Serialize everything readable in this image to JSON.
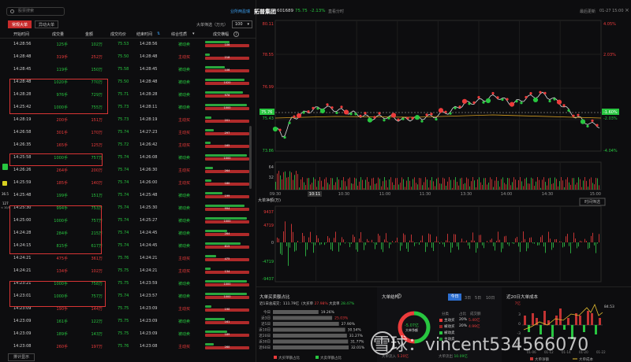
{
  "search": {
    "placeholder": "股票搜索"
  },
  "tabs": [
    {
      "label": "常规大单"
    },
    {
      "label": "异动大单"
    }
  ],
  "filter": {
    "label": "大单筛选（万元）",
    "value": "100"
  },
  "headers": [
    "开始时间",
    "成交量",
    "金额",
    "成交均价",
    "结束时间",
    "综合性质",
    "成交横幅"
  ],
  "rows": [
    {
      "start": "14:28:56",
      "vol": "125手",
      "amt": "102万",
      "price": "75.53",
      "end": "14:28:56",
      "type": "被动卖",
      "vc": "g",
      "tt": "g",
      "top": 0.55,
      "mid": "106"
    },
    {
      "start": "14:28:48",
      "vol": "319手",
      "amt": "252万",
      "price": "75.50",
      "end": "14:28:48",
      "type": "主动买",
      "vc": "r",
      "tt": "r",
      "top": 0.1,
      "mid": "218"
    },
    {
      "start": "14:28:45",
      "vol": "119手",
      "amt": "150万",
      "price": "75.58",
      "end": "14:28:45",
      "type": "被动卖",
      "vc": "g",
      "tt": "g",
      "top": 0.45,
      "mid": "106"
    },
    {
      "start": "14:28:48",
      "vol": "1020手",
      "amt": "770万",
      "price": "75.50",
      "end": "14:28:48",
      "type": "被动卖",
      "vc": "g",
      "tt": "g",
      "top": 0.9,
      "mid": "1020"
    },
    {
      "start": "14:28:28",
      "vol": "976手",
      "amt": "729万",
      "price": "75.71",
      "end": "14:28:28",
      "type": "被动卖",
      "vc": "g",
      "tt": "g",
      "top": 0.85,
      "mid": "976"
    },
    {
      "start": "14:25:42",
      "vol": "1000手",
      "amt": "755万",
      "price": "75.73",
      "end": "14:28:11",
      "type": "被动卖",
      "vc": "g",
      "tt": "g",
      "top": 0.95,
      "mid": "1000"
    },
    {
      "start": "14:28:19",
      "vol": "200手",
      "amt": "151万",
      "price": "75.73",
      "end": "14:28:19",
      "type": "主动买",
      "vc": "r",
      "tt": "r",
      "top": 0.15,
      "mid": "201"
    },
    {
      "start": "14:26:58",
      "vol": "301手",
      "amt": "170万",
      "price": "75.74",
      "end": "14:27:23",
      "type": "主动买",
      "vc": "r",
      "tt": "r",
      "top": 0.2,
      "mid": "297"
    },
    {
      "start": "14:26:35",
      "vol": "165手",
      "amt": "125万",
      "price": "75.72",
      "end": "14:26:42",
      "type": "主动买",
      "vc": "r",
      "tt": "r",
      "top": 0.12,
      "mid": "165"
    },
    {
      "start": "14:25:58",
      "vol": "1000手",
      "amt": "757万",
      "price": "75.74",
      "end": "14:26:08",
      "type": "被动卖",
      "vc": "g",
      "tt": "g",
      "top": 0.95,
      "mid": "1000"
    },
    {
      "start": "14:26:26",
      "vol": "264手",
      "amt": "200万",
      "price": "75.74",
      "end": "14:26:30",
      "type": "主动买",
      "vc": "r",
      "tt": "r",
      "top": 0.18,
      "mid": "264"
    },
    {
      "start": "14:25:59",
      "vol": "185手",
      "amt": "140万",
      "price": "75.74",
      "end": "14:26:00",
      "type": "主动买",
      "vc": "r",
      "tt": "r",
      "top": 0.14,
      "mid": "180"
    },
    {
      "start": "14:25:48",
      "vol": "199手",
      "amt": "151万",
      "price": "75.74",
      "end": "14:25:48",
      "type": "被动卖",
      "vc": "g",
      "tt": "g",
      "top": 0.4,
      "mid": "199"
    },
    {
      "start": "14:25:30",
      "vol": "994手",
      "amt": "753万",
      "price": "75.74",
      "end": "14:25:30",
      "type": "被动卖",
      "vc": "g",
      "tt": "g",
      "top": 0.9,
      "mid": "994"
    },
    {
      "start": "14:25:00",
      "vol": "1000手",
      "amt": "757万",
      "price": "75.74",
      "end": "14:25:27",
      "type": "被动卖",
      "vc": "g",
      "tt": "g",
      "top": 0.95,
      "mid": "1000"
    },
    {
      "start": "14:24:28",
      "vol": "284手",
      "amt": "215万",
      "price": "75.74",
      "end": "14:24:45",
      "type": "被动卖",
      "vc": "g",
      "tt": "g",
      "top": 0.5,
      "mid": "284"
    },
    {
      "start": "14:24:15",
      "vol": "815手",
      "amt": "617万",
      "price": "75.74",
      "end": "14:24:45",
      "type": "被动卖",
      "vc": "g",
      "tt": "g",
      "top": 0.8,
      "mid": "815"
    },
    {
      "start": "14:24:21",
      "vol": "475手",
      "amt": "361万",
      "price": "75.76",
      "end": "14:24:21",
      "type": "主动买",
      "vc": "r",
      "tt": "r",
      "top": 0.25,
      "mid": "475"
    },
    {
      "start": "14:24:21",
      "vol": "134手",
      "amt": "102万",
      "price": "75.75",
      "end": "14:24:21",
      "type": "主动买",
      "vc": "r",
      "tt": "r",
      "top": 0.12,
      "mid": "134"
    },
    {
      "start": "14:23:21",
      "vol": "1000手",
      "amt": "758万",
      "price": "75.75",
      "end": "14:23:59",
      "type": "被动卖",
      "vc": "g",
      "tt": "g",
      "top": 0.95,
      "mid": "1000"
    },
    {
      "start": "14:23:01",
      "vol": "1000手",
      "amt": "757万",
      "price": "75.74",
      "end": "14:23:57",
      "type": "被动卖",
      "vc": "g",
      "tt": "g",
      "top": 0.95,
      "mid": "1000"
    },
    {
      "start": "14:23:09",
      "vol": "190手",
      "amt": "144万",
      "price": "75.75",
      "end": "14:23:09",
      "type": "主动买",
      "vc": "r",
      "tt": "r",
      "top": 0.15,
      "mid": "190"
    },
    {
      "start": "14:23:09",
      "vol": "161手",
      "amt": "122万",
      "price": "75.75",
      "end": "14:23:09",
      "type": "被动卖",
      "vc": "g",
      "tt": "g",
      "top": 0.45,
      "mid": "161"
    },
    {
      "start": "14:23:09",
      "vol": "189手",
      "amt": "143万",
      "price": "75.75",
      "end": "14:23:09",
      "type": "被动卖",
      "vc": "g",
      "tt": "g",
      "top": 0.5,
      "mid": "189"
    },
    {
      "start": "14:23:08",
      "vol": "260手",
      "amt": "197万",
      "price": "75.76",
      "end": "14:23:08",
      "type": "主动买",
      "vc": "r",
      "tt": "r",
      "top": 0.2,
      "mid": "260"
    }
  ],
  "side": {
    "v1": "36.5",
    "v2": "127",
    "v3": "< 10/5"
  },
  "bottom_btn": "排计显示",
  "header": {
    "link": "业所两盈瑞",
    "name": "拓普集团",
    "code": "601689",
    "price": "75.75",
    "chg": "-2.13%",
    "extra": "直看分时",
    "refresh": "最后更新",
    "date": "01-27 15:00"
  },
  "price_axis": {
    "left": [
      "80.11",
      "78.55",
      "76.99",
      "75.76",
      "75.43",
      "73.86"
    ],
    "right": [
      "4.05%",
      "2.03%",
      "",
      "-1.60%",
      "-2.03%",
      "-4.04%"
    ]
  },
  "vol_axis": [
    "64",
    "32"
  ],
  "time_axis": [
    "09:30",
    "10:11",
    "10:30",
    "11:00",
    "11:30",
    "13:30",
    "14:00",
    "14:30",
    "15:00"
  ],
  "big_order": {
    "title": "大单净额(万)",
    "btn": "时间筛选",
    "ticks": [
      "9437",
      "4719",
      "0",
      "-4719",
      "-9437"
    ]
  },
  "panel1": {
    "title": "大单买卖额占比",
    "sub_label": "近1日总成交：",
    "sub_value": "111.79亿",
    "buy_label": "大买单",
    "buy_pct": "27.98%",
    "sell_label": "大卖单",
    "sell_pct": "28.47%",
    "rows": [
      {
        "l": "今日",
        "v": "19.26%"
      },
      {
        "l": "近3日",
        "v": "25.03%"
      },
      {
        "l": "近5日",
        "v": "27.90%"
      },
      {
        "l": "近10日",
        "v": "30.54%"
      },
      {
        "l": "近20日",
        "v": "31.27%"
      },
      {
        "l": "近30日",
        "v": "31.77%"
      },
      {
        "l": "近60日",
        "v": "32.01%"
      }
    ],
    "legend": [
      "大买单额占比",
      "大卖单额占比"
    ]
  },
  "panel2": {
    "title": "大单结构",
    "tabs": [
      "今日",
      "3日",
      "5日",
      "10日"
    ],
    "center_top": "-5.07亿",
    "center_bottom": "大单净额",
    "head": [
      "分类",
      "占比",
      "成交额"
    ],
    "rows": [
      {
        "l": "主动买",
        "p": "20%",
        "v": "5.40亿",
        "c": "#ec3b3b"
      },
      {
        "l": "被动买",
        "p": "20%",
        "v": "4.99亿",
        "c": "#9a2020"
      },
      {
        "l": "被动卖",
        "p": "",
        "v": "",
        "c": "#28c640"
      },
      {
        "l": "主动卖",
        "p": "",
        "v": "",
        "c": "#1b8a2e"
      }
    ],
    "foot_l": "大单流入",
    "foot_lv": "5.20亿",
    "foot_r": "大单流出",
    "foot_rv": "10.09亿"
  },
  "panel3": {
    "title": "近20日大单成本",
    "y": [
      "7亿",
      "3",
      "0",
      "-3",
      "-7亿"
    ],
    "right_value": "84.53",
    "dates": [
      "01-06",
      "01-12",
      "01-14",
      "01-20",
      "01-22"
    ],
    "legend": [
      "大单净额",
      "大单成本"
    ]
  },
  "watermark": "雪球：vincent534566070"
}
